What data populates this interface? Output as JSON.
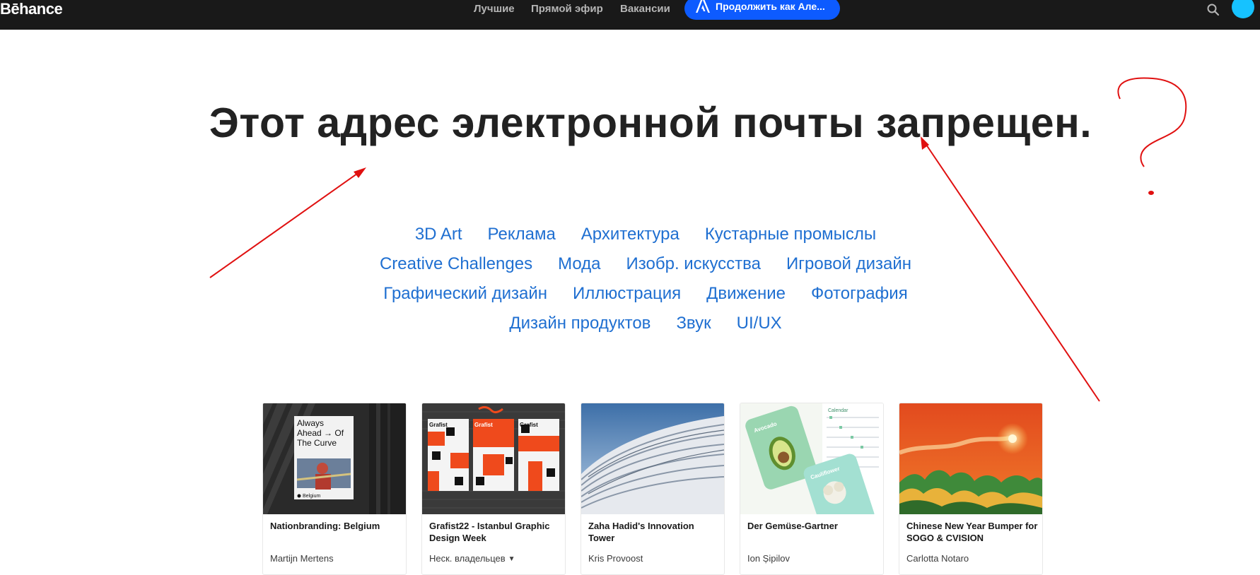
{
  "header": {
    "logo": "Bēhance",
    "nav": [
      {
        "label": "Лучшие"
      },
      {
        "label": "Прямой эфир"
      },
      {
        "label": "Вакансии"
      }
    ],
    "continue_button": "Продолжить как Але...",
    "icons": {
      "search": "search-icon",
      "adobe": "adobe-icon",
      "avatar": "avatar"
    }
  },
  "main": {
    "title": "Этот адрес электронной почты запрещен.",
    "categories": [
      [
        "3D Art",
        "Реклама",
        "Архитектура",
        "Кустарные промыслы"
      ],
      [
        "Creative Challenges",
        "Мода",
        "Изобр. искусства",
        "Игровой дизайн"
      ],
      [
        "Графический дизайн",
        "Иллюстрация",
        "Движение",
        "Фотография"
      ],
      [
        "Дизайн продуктов",
        "Звук",
        "UI/UX"
      ]
    ]
  },
  "projects": [
    {
      "title": "Nationbranding: Belgium",
      "owner": "Martijn Mertens",
      "poster_text": [
        "Always",
        "Ahead → Of",
        "The Curve"
      ],
      "poster_brand": "Belgium"
    },
    {
      "title": "Grafist22 - Istanbul Graphic Design Week",
      "owner": "Неск. владельцев",
      "multiple_owners": true,
      "poster_brand": "Grafist"
    },
    {
      "title": "Zaha Hadid's Innovation Tower",
      "owner": "Kris Provoost"
    },
    {
      "title": "Der Gemüse-Gartner",
      "owner": "Ion Șipilov",
      "app_labels": [
        "Avocado",
        "Cauliflower",
        "Calendar"
      ]
    },
    {
      "title": "Chinese New Year Bumper for SOGO & CVISION",
      "owner": "Carlotta Notaro"
    }
  ],
  "annotation": {
    "color": "#e01010",
    "marks": [
      "arrow-to-title-left",
      "arrow-to-title-right",
      "question-mark"
    ]
  }
}
